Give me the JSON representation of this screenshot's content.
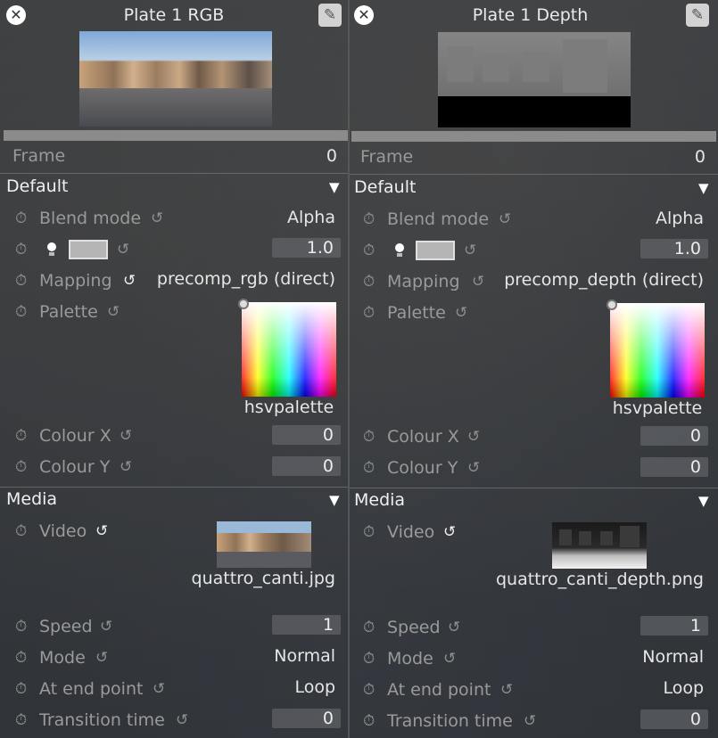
{
  "panels": [
    {
      "title": "Plate 1 RGB",
      "frame_label": "Frame",
      "frame_value": "0",
      "default_section": {
        "header": "Default",
        "blend_mode_label": "Blend mode",
        "blend_mode_value": "Alpha",
        "opacity_value": "1.0",
        "mapping_label": "Mapping",
        "mapping_value": "precomp_rgb (direct)",
        "palette_label": "Palette",
        "palette_name": "hsvpalette",
        "colour_x_label": "Colour X",
        "colour_x_value": "0",
        "colour_y_label": "Colour Y",
        "colour_y_value": "0"
      },
      "media_section": {
        "header": "Media",
        "video_label": "Video",
        "video_file": "quattro_canti.jpg",
        "speed_label": "Speed",
        "speed_value": "1",
        "mode_label": "Mode",
        "mode_value": "Normal",
        "end_point_label": "At end point",
        "end_point_value": "Loop",
        "transition_label": "Transition time",
        "transition_value": "0"
      }
    },
    {
      "title": "Plate 1 Depth",
      "frame_label": "Frame",
      "frame_value": "0",
      "default_section": {
        "header": "Default",
        "blend_mode_label": "Blend mode",
        "blend_mode_value": "Alpha",
        "opacity_value": "1.0",
        "mapping_label": "Mapping",
        "mapping_value": "precomp_depth (direct)",
        "palette_label": "Palette",
        "palette_name": "hsvpalette",
        "colour_x_label": "Colour X",
        "colour_x_value": "0",
        "colour_y_label": "Colour Y",
        "colour_y_value": "0"
      },
      "media_section": {
        "header": "Media",
        "video_label": "Video",
        "video_file": "quattro_canti_depth.png",
        "speed_label": "Speed",
        "speed_value": "1",
        "mode_label": "Mode",
        "mode_value": "Normal",
        "end_point_label": "At end point",
        "end_point_value": "Loop",
        "transition_label": "Transition time",
        "transition_value": "0"
      }
    }
  ],
  "icons": {
    "close": "close-icon",
    "notes": "add-note-icon",
    "keyframe": "stopwatch-icon",
    "reset": "reset-icon",
    "collapse": "triangle-down-icon",
    "light": "bulb-icon"
  },
  "colors": {
    "panel_bg": "#323438",
    "label": "#9a9a9a",
    "value": "#e6e6e6",
    "field_bg": "#6e7074",
    "swatch": "#b5b5b5"
  }
}
